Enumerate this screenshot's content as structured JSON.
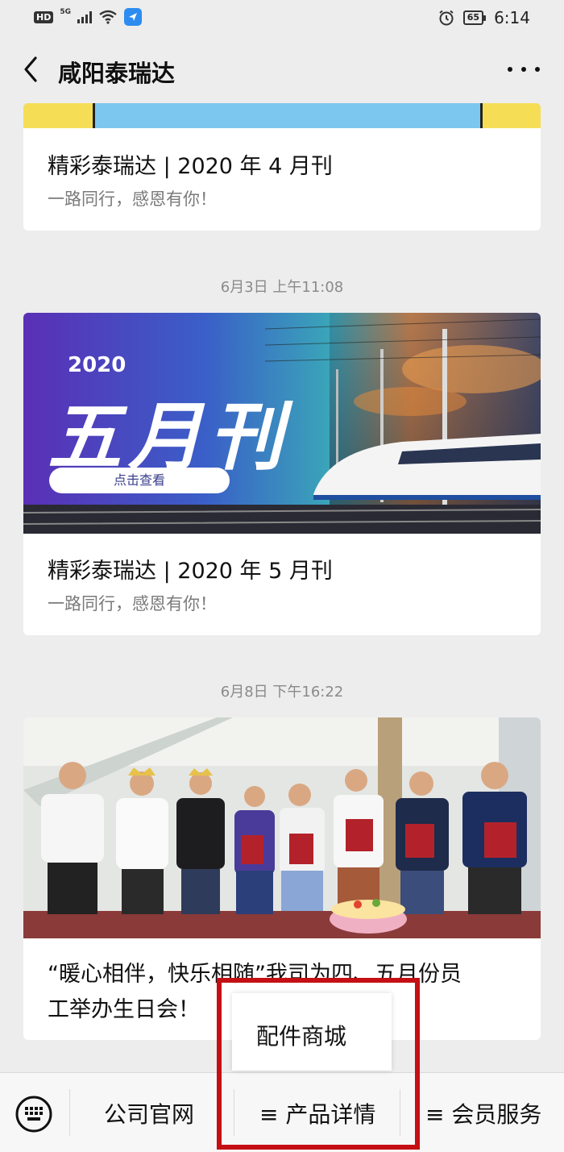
{
  "status_bar": {
    "hd": "HD",
    "network": "5G",
    "battery": "65",
    "time": "6:14"
  },
  "nav": {
    "title": "咸阳泰瑞达"
  },
  "feed": [
    {
      "title": "精彩泰瑞达 | 2020 年 4 月刊",
      "subtitle": "一路同行，感恩有你！"
    },
    {
      "timestamp": "6月3日 上午11:08",
      "banner_year": "2020",
      "banner_title": "五月刊",
      "banner_button": "点击查看",
      "title": "精彩泰瑞达 | 2020 年 5 月刊",
      "subtitle": "一路同行，感恩有你！"
    },
    {
      "timestamp": "6月8日 下午16:22",
      "title_line1": "“暖心相伴，快乐相随”我司为四、五月份员",
      "title_line2": "工举办生日会！"
    }
  ],
  "popup_menu": {
    "items": [
      "配件商城"
    ]
  },
  "bottom_menu": {
    "items": [
      "公司官网",
      "≡ 产品详情",
      "≡ 会员服务"
    ]
  },
  "colors": {
    "highlight": "#c40f14",
    "background": "#ededed"
  }
}
